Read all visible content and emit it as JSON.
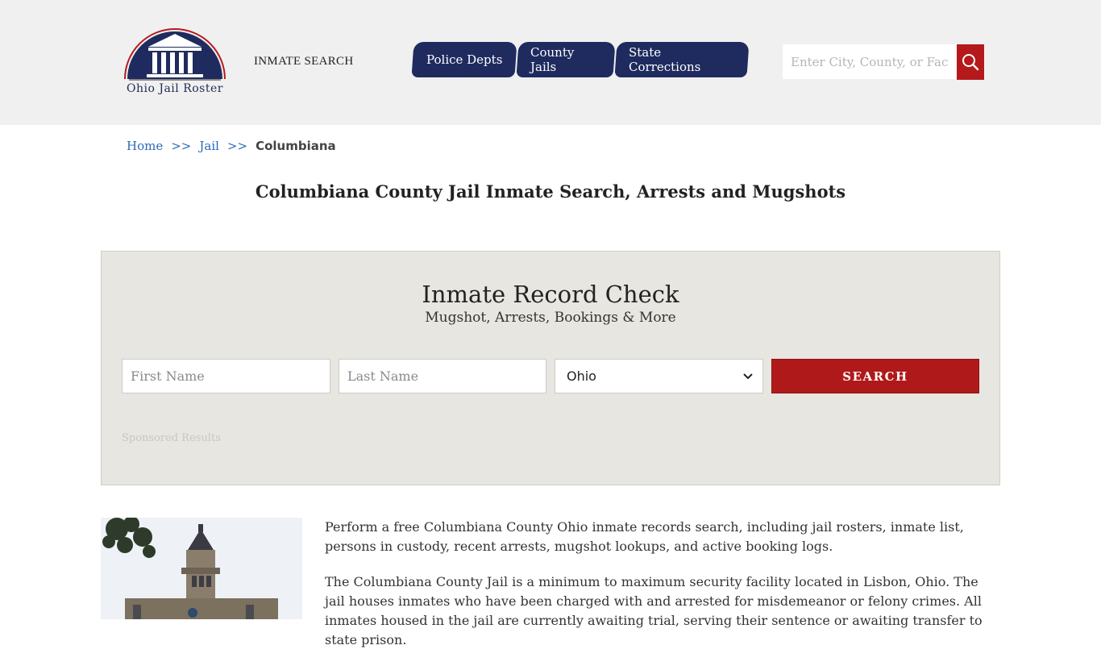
{
  "header": {
    "logo_text": "Ohio Jail Roster",
    "inmate_search_label": "INMATE SEARCH",
    "nav_tabs": [
      {
        "label": "Police Depts"
      },
      {
        "label": "County Jails"
      },
      {
        "label": "State Corrections"
      }
    ],
    "search": {
      "placeholder": "Enter City, County, or Facility",
      "icon": "search-icon"
    }
  },
  "breadcrumb": {
    "home": "Home",
    "sep1": ">>",
    "jail": "Jail",
    "sep2": ">>",
    "current": "Columbiana"
  },
  "page_title": "Columbiana County Jail Inmate Search, Arrests and Mugshots",
  "record_check": {
    "title": "Inmate Record Check",
    "subtitle": "Mugshot, Arrests, Bookings & More",
    "first_name_placeholder": "First Name",
    "last_name_placeholder": "Last Name",
    "state_selected": "Ohio",
    "search_button": "SEARCH",
    "sponsored_label": "Sponsored Results"
  },
  "content": {
    "paragraph1": "Perform a free Columbiana County Ohio inmate records search, including jail rosters, inmate list, persons in custody, recent arrests, mugshot lookups, and active booking logs.",
    "paragraph2": "The Columbiana County Jail is a minimum to maximum security facility located in Lisbon, Ohio. The jail houses inmates who have been charged with and arrested for misdemeanor or felony crimes. All inmates housed in the jail are currently awaiting trial, serving their sentence or awaiting transfer to state prison."
  },
  "colors": {
    "header_bg": "#f0f0f0",
    "nav_bg": "#1f2b5f",
    "accent_red": "#b0191a",
    "link_blue": "#2a6ab8",
    "panel_bg": "#e8e6e1"
  }
}
